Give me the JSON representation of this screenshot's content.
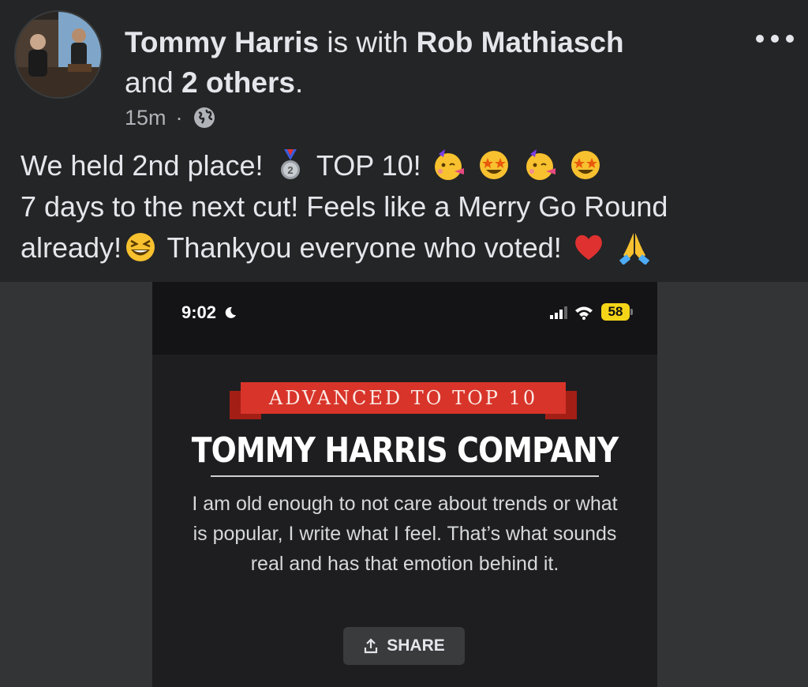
{
  "post": {
    "author": "Tommy Harris",
    "with_text": "is with",
    "tagged": "Rob Mathiasch",
    "and_text": "and",
    "others": "2 others",
    "period": ".",
    "time": "15m",
    "separator": "·",
    "privacy_icon": "globe-icon",
    "more_icon": "more-options-icon",
    "text_line1_a": "We held 2nd place!",
    "text_line1_b": "TOP 10!",
    "text_line2": "7 days to the next cut! Feels like a Merry Go Round",
    "text_line3_a": "already!",
    "text_line3_b": "Thankyou everyone who voted!"
  },
  "screenshot": {
    "time": "9:02",
    "battery": "58",
    "banner": "ADVANCED TO TOP 10",
    "company": "TOMMY HARRIS COMPANY",
    "quote": "I am old enough to not care about trends or what is popular, I write what I feel. That’s what sounds real and has that emotion behind it.",
    "share_label": "SHARE"
  },
  "colors": {
    "background": "#242526",
    "ribbon": "#d8342a",
    "battery": "#f5d518"
  }
}
